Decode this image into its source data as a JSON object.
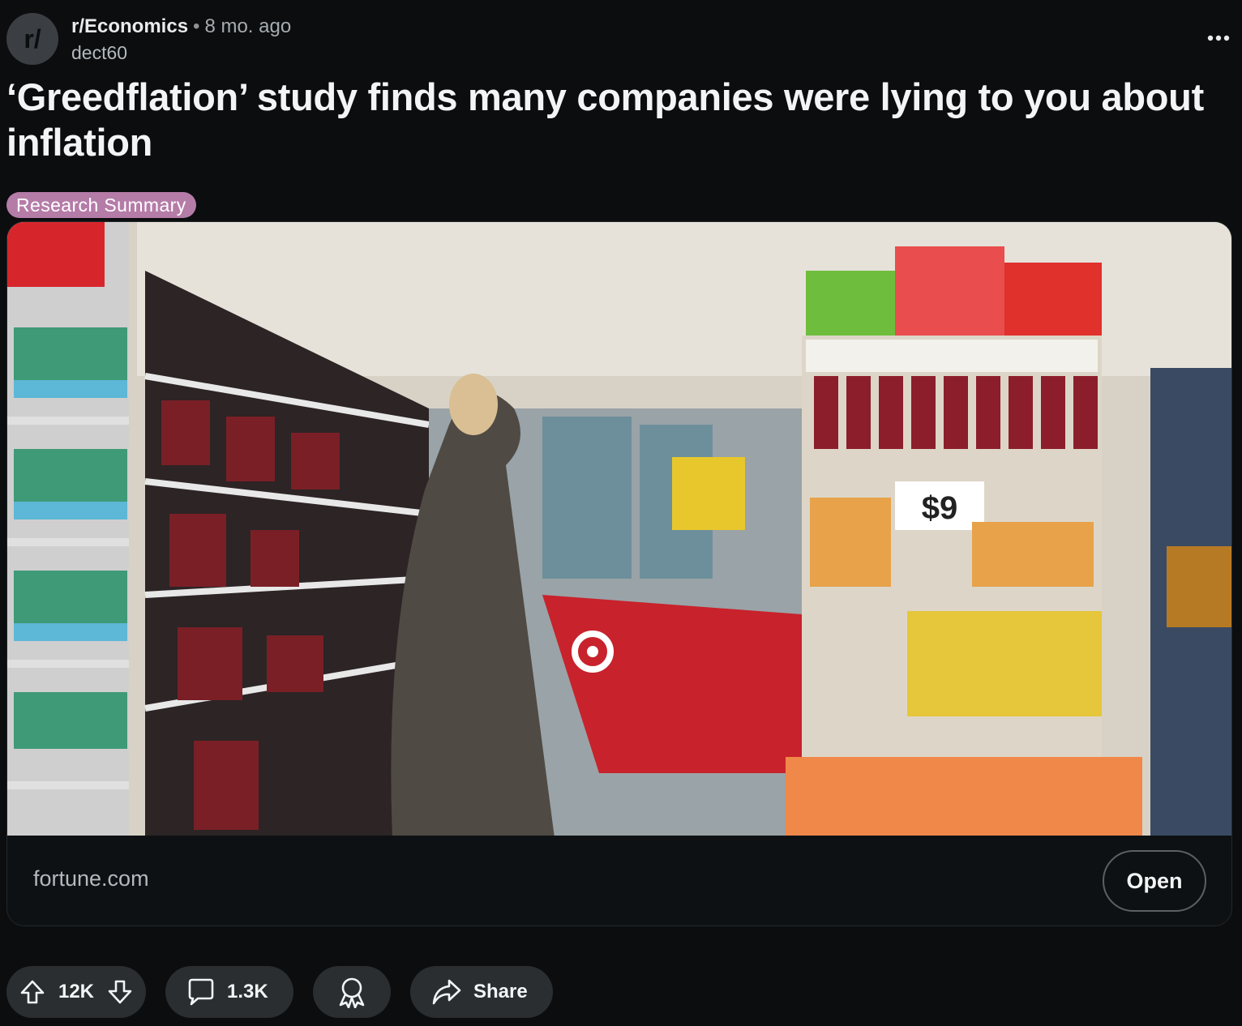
{
  "post": {
    "subreddit": "r/Economics",
    "separator": "•",
    "age": "8 mo. ago",
    "author": "dect60",
    "avatar_text": "r/",
    "title": "‘Greedflation’ study finds many companies were lying to you about inflation",
    "flair": "Research Summary"
  },
  "link_card": {
    "domain": "fortune.com",
    "open_label": "Open",
    "image_icon": "shopper-in-wine-aisle-photo",
    "price_sign": "$9"
  },
  "actions": {
    "score": "12K",
    "comments": "1.3K",
    "share_label": "Share",
    "icons": [
      "upvote-icon",
      "downvote-icon",
      "comment-icon",
      "award-icon",
      "share-icon",
      "more-icon"
    ]
  },
  "colors": {
    "background": "#0b0d0f",
    "flair_bg": "#b57ca8",
    "pill_bg": "#2a2e31",
    "cart_red": "#c8222c"
  }
}
